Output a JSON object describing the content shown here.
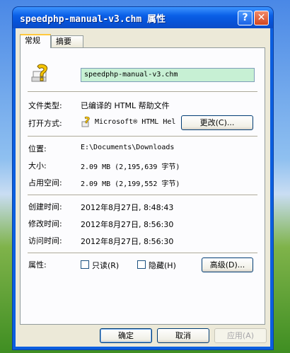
{
  "window": {
    "title": "speedphp-manual-v3.chm 属性",
    "help_glyph": "?",
    "close_glyph": "✕"
  },
  "tabs": [
    {
      "label": "常规",
      "active": true
    },
    {
      "label": "摘要",
      "active": false
    }
  ],
  "general": {
    "file_name": "speedphp-manual-v3.chm",
    "file_type_label": "文件类型:",
    "file_type_value": "已编译的 HTML 帮助文件",
    "open_with_label": "打开方式:",
    "open_with_value": "Microsoft® HTML Hel",
    "change_button": "更改(C)...",
    "location_label": "位置:",
    "location_value": "E:\\Documents\\Downloads",
    "size_label": "大小:",
    "size_value": "2.09 MB (2,195,639 字节)",
    "size_on_disk_label": "占用空间:",
    "size_on_disk_value": "2.09 MB (2,199,552 字节)",
    "created_label": "创建时间:",
    "created_value": "2012年8月27日, 8:48:43",
    "modified_label": "修改时间:",
    "modified_value": "2012年8月27日, 8:56:30",
    "accessed_label": "访问时间:",
    "accessed_value": "2012年8月27日, 8:56:30",
    "attributes_label": "属性:",
    "readonly_label": "只读(R)",
    "readonly_checked": false,
    "hidden_label": "隐藏(H)",
    "hidden_checked": false,
    "advanced_button": "高级(D)..."
  },
  "footer": {
    "ok": "确定",
    "cancel": "取消",
    "apply": "应用(A)"
  },
  "colors": {
    "title_bar": "#0a5fe7",
    "dialog_bg": "#ece9d8",
    "filename_box": "#c7f0d4",
    "close_button": "#d2461f"
  }
}
